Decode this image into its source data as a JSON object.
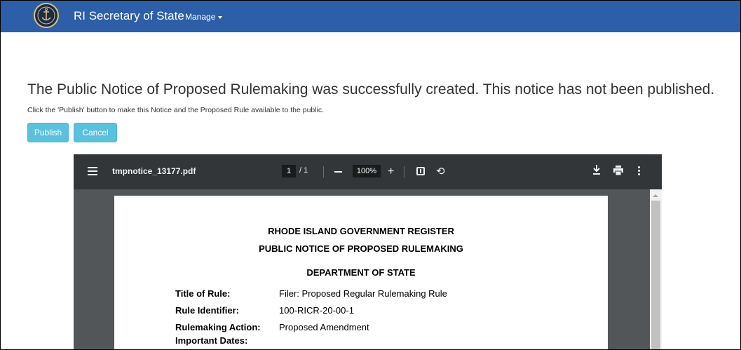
{
  "nav": {
    "brand": "RI Secretary of State",
    "manage_label": "Manage"
  },
  "message": {
    "headline": "The Public Notice of Proposed Rulemaking was successfully created. This notice has not been published.",
    "instruction": "Click the 'Publish' button to make this Notice and the Proposed Rule available to the public."
  },
  "actions": {
    "publish_label": "Publish",
    "cancel_label": "Cancel"
  },
  "pdf_viewer": {
    "file_name": "tmpnotice_13177.pdf",
    "current_page": "1",
    "page_total": "/ 1",
    "zoom": "100%",
    "icons": [
      "menu-icon",
      "zoom-out-icon",
      "zoom-in-icon",
      "fit-page-icon",
      "rotate-icon",
      "download-icon",
      "print-icon",
      "more-options-icon"
    ]
  },
  "document": {
    "heading1": "RHODE ISLAND GOVERNMENT REGISTER",
    "heading2": "PUBLIC NOTICE OF PROPOSED RULEMAKING",
    "department": "DEPARTMENT OF STATE",
    "fields": [
      {
        "label": "Title of Rule:",
        "value": "Filer: Proposed Regular Rulemaking Rule"
      },
      {
        "label": "Rule Identifier:",
        "value": "100-RICR-20-00-1"
      },
      {
        "label": "Rulemaking Action:",
        "value": "Proposed Amendment"
      },
      {
        "label": "Important Dates:",
        "value": ""
      }
    ]
  },
  "colors": {
    "navbar": "#2d5ea8",
    "button": "#5bc0de",
    "viewer_toolbar": "#323639",
    "viewer_background": "#525659"
  }
}
